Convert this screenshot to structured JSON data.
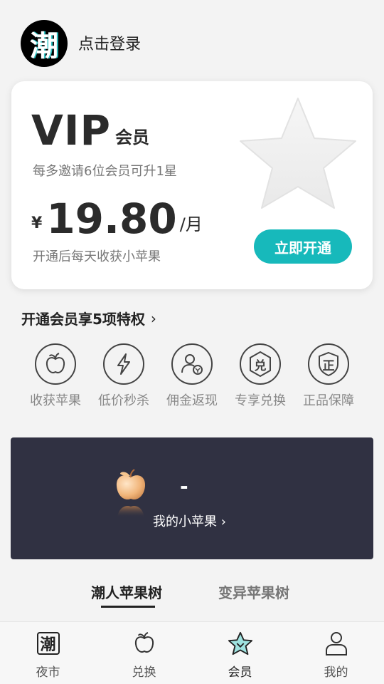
{
  "header": {
    "logo_char": "潮",
    "login_text": "点击登录"
  },
  "vip_card": {
    "title_big": "VIP",
    "title_small": "会员",
    "description": "每多邀请6位会员可升1星",
    "currency": "¥",
    "price": "19.80",
    "price_unit": "/月",
    "price_note": "开通后每天收获小苹果",
    "open_button": "立即开通"
  },
  "privileges": {
    "title": "开通会员享5项特权",
    "chevron": "›",
    "items": [
      {
        "label": "收获苹果",
        "icon": "apple-icon"
      },
      {
        "label": "低价秒杀",
        "icon": "lightning-icon"
      },
      {
        "label": "佣金返现",
        "icon": "user-refund-icon"
      },
      {
        "label": "专享兑换",
        "icon": "exchange-badge-icon",
        "glyph": "兑"
      },
      {
        "label": "正品保障",
        "icon": "shield-icon",
        "glyph": "正"
      }
    ]
  },
  "apple_panel": {
    "count": "-",
    "link_text": "我的小苹果 ›"
  },
  "tabs": {
    "active": "潮人苹果树",
    "inactive": "变异苹果树"
  },
  "bottom_nav": [
    {
      "label": "夜市",
      "icon": "night-market-icon",
      "glyph": "潮"
    },
    {
      "label": "兑换",
      "icon": "apple-outline-icon"
    },
    {
      "label": "会员",
      "icon": "star-icon",
      "active": true
    },
    {
      "label": "我的",
      "icon": "person-icon"
    }
  ],
  "colors": {
    "accent": "#17b9bb",
    "panel_bg": "#303142",
    "page_bg": "#f3f3f3"
  }
}
